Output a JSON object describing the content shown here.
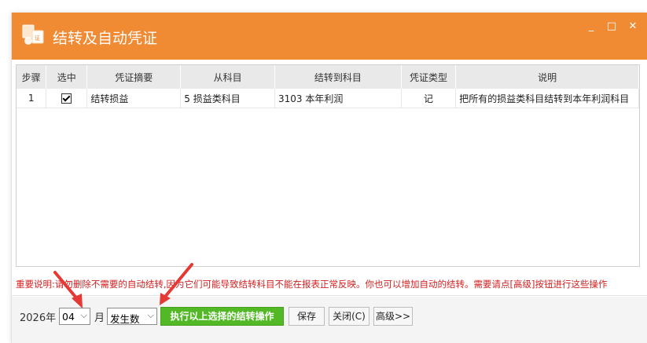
{
  "window": {
    "title": "结转及自动凭证",
    "controls": {
      "minimize": "_",
      "maximize": "□",
      "close": "✕"
    }
  },
  "table": {
    "headers": [
      "步骤",
      "选中",
      "凭证摘要",
      "从科目",
      "结转到科目",
      "凭证类型",
      "说明"
    ],
    "rows": [
      {
        "step": "1",
        "checked": true,
        "summary": "结转损益",
        "from": "5 损益类科目",
        "to": "3103 本年利润",
        "type": "记",
        "desc": "把所有的损益类科目结转到本年利润科目"
      }
    ]
  },
  "note": "重要说明:请勿删除不需要的自动结转,因为它们可能导致结转科目不能在报表正常反映。你也可以增加自动的结转。需要请点[高级]按钮进行这些操作",
  "footer": {
    "year_label": "2026年",
    "month_value": "04",
    "month_label": "月",
    "amount_type": "发生数",
    "execute_label": "执行以上选择的结转操作",
    "save_label": "保存",
    "close_label": "关闭(C)",
    "advanced_label": "高级>>"
  },
  "colors": {
    "titlebar": "#f08a33",
    "execute": "#52b826",
    "note": "#d31f1f",
    "arrow": "#e53935"
  }
}
